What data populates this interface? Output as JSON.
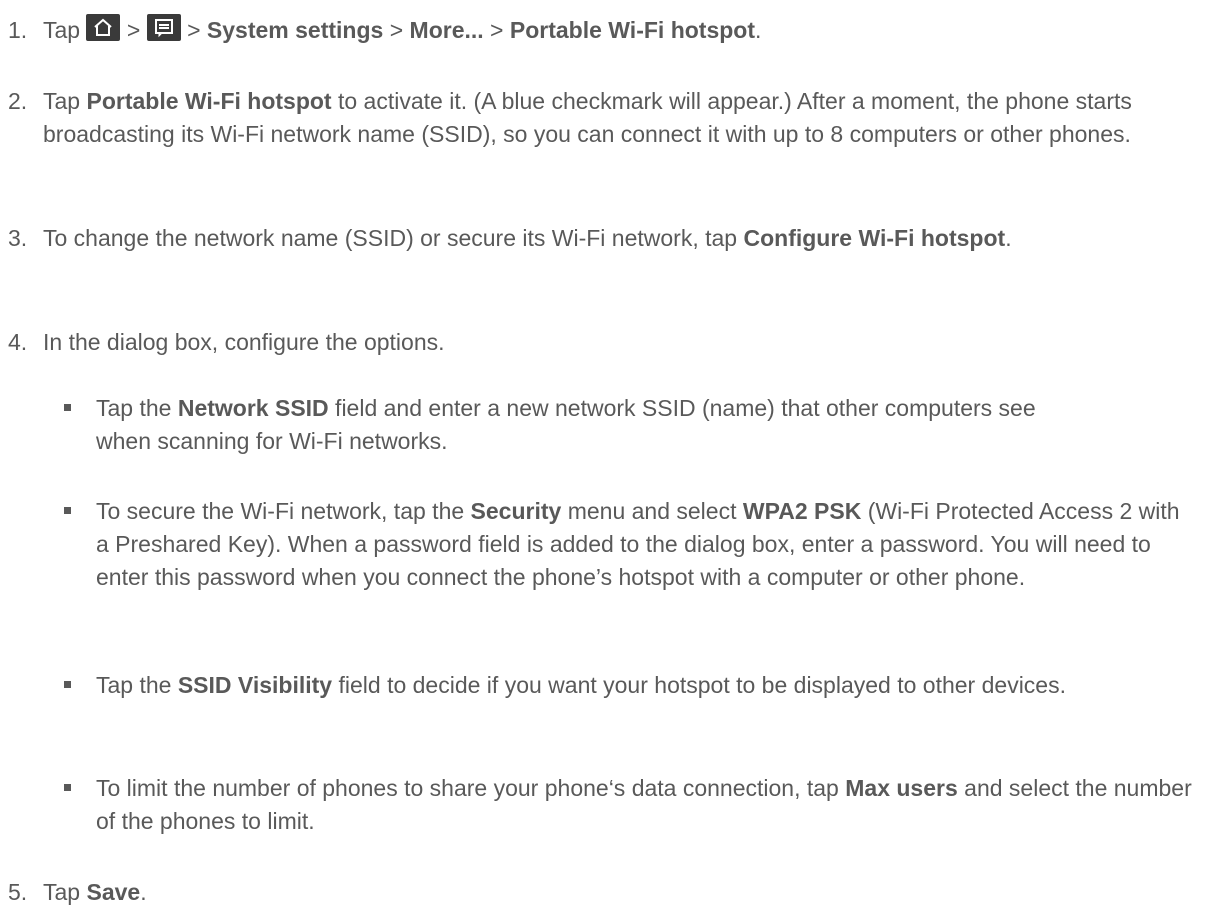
{
  "steps": [
    {
      "number": "1.",
      "parts": [
        "Tap ",
        " > ",
        " > ",
        "System settings",
        " > ",
        "More...",
        " > ",
        "Portable Wi-Fi hotspot",
        "."
      ],
      "icons": [
        "home-icon",
        "menu-icon"
      ]
    },
    {
      "number": "2.",
      "parts": [
        "Tap ",
        "Portable Wi-Fi hotspot",
        " to activate it. (A blue checkmark will appear.) After a moment, the phone starts broadcasting its Wi-Fi network name (SSID), so you can connect it with up to 8 computers or other phones."
      ]
    },
    {
      "number": "3.",
      "parts": [
        "To change the network name (SSID) or secure its Wi-Fi network, tap ",
        "Configure Wi-Fi hotspot",
        "."
      ]
    },
    {
      "number": "4.",
      "parts": [
        "In the dialog box, configure the options."
      ]
    },
    {
      "number": "5.",
      "parts": [
        "Tap ",
        "Save",
        "."
      ]
    }
  ],
  "sub_steps": [
    {
      "parts": [
        "Tap the ",
        "Network SSID",
        " field and enter a new network SSID (name) that other computers see when scanning for Wi-Fi networks."
      ]
    },
    {
      "parts": [
        "To secure the Wi-Fi network, tap the ",
        "Security",
        " menu and select ",
        "WPA2 PSK",
        " (Wi-Fi Protected Access 2 with a Preshared Key). When a password field is added to the dialog box, enter a password. You will need to enter this password when you connect the phone’s hotspot with a computer or other phone."
      ]
    },
    {
      "parts": [
        "Tap the ",
        "SSID Visibility",
        " field to decide if you want your hotspot to be displayed to other devices."
      ]
    },
    {
      "parts": [
        "To limit the number of phones to share your phone‘s data connection, tap ",
        "Max users",
        " and select the number of the phones to limit."
      ]
    }
  ],
  "colors": {
    "text": "#595959",
    "icon_bg": "#3a3a3a",
    "icon_fg": "#ffffff"
  }
}
